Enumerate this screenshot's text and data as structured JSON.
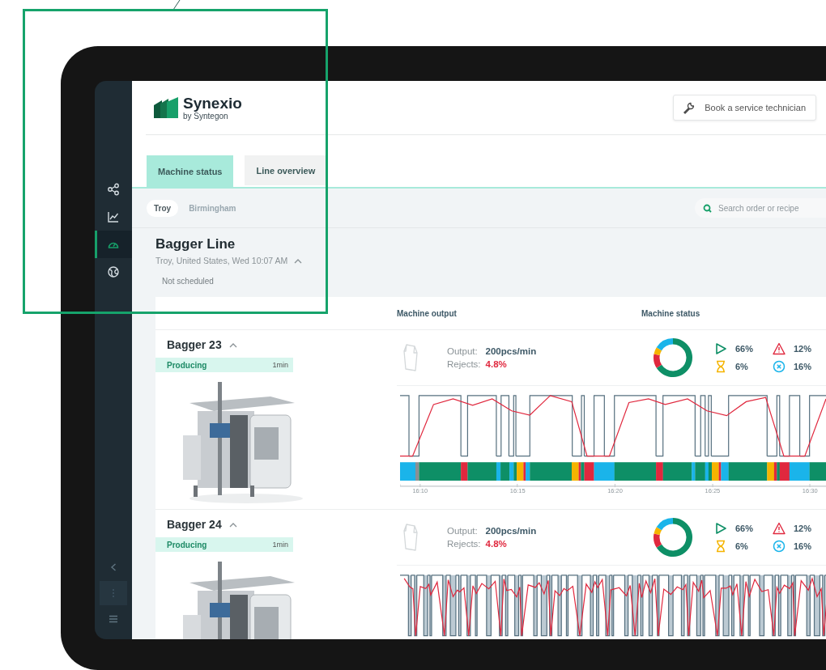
{
  "sidebar": {
    "nav_items": [
      {
        "kind": "network",
        "selected": false
      },
      {
        "kind": "chart",
        "selected": false
      },
      {
        "kind": "gauge",
        "selected": true
      },
      {
        "kind": "globe",
        "selected": false
      }
    ],
    "footer_items": [
      {
        "kind": "collapse",
        "selected": false
      },
      {
        "kind": "more",
        "selected": true
      },
      {
        "kind": "menu",
        "selected": false
      }
    ]
  },
  "header": {
    "logo": {
      "name": "Synexio",
      "tagline": "by Syntegon"
    },
    "action_button": "Book a service technician"
  },
  "tabs": [
    {
      "label": "Machine status",
      "selected": true
    },
    {
      "label": "Line overview",
      "selected": false
    }
  ],
  "locations": [
    {
      "label": "Troy",
      "selected": true
    },
    {
      "label": "Birmingham",
      "selected": false
    }
  ],
  "search": {
    "placeholder": "Search order or recipe"
  },
  "line": {
    "title": "Bagger Line",
    "subtitle": "Troy, United States, Wed 10:07 AM",
    "expanded": true,
    "schedule": "Not scheduled"
  },
  "table": {
    "columns": [
      "Machine output",
      "Machine status"
    ],
    "machines": [
      {
        "name": "Bagger 23",
        "expanded": true,
        "status": "Producing",
        "duration": "1min",
        "output_label": "Output:",
        "output": "200pcs/min",
        "rejects_label": "Rejects:",
        "rejects": "4.8%",
        "status_chart": {
          "chart_data": {
            "type": "donut",
            "values": [
              66,
              12,
              6,
              16
            ]
          }
        },
        "legend": [
          {
            "kind": "running",
            "value": "66%",
            "color": "#0e8f66"
          },
          {
            "kind": "fault",
            "value": "12%",
            "color": "#e0283e"
          },
          {
            "kind": "waiting",
            "value": "6%",
            "color": "#f5b400"
          },
          {
            "kind": "stopped",
            "value": "16%",
            "color": "#1ab4ea"
          }
        ],
        "timeline": {
          "kind": "sparse",
          "axis_labels": [
            "16:10",
            "16:15",
            "16:20",
            "16:25",
            "16:30"
          ]
        }
      },
      {
        "name": "Bagger 24",
        "expanded": true,
        "status": "Producing",
        "duration": "1min",
        "output_label": "Output:",
        "output": "200pcs/min",
        "rejects_label": "Rejects:",
        "rejects": "4.8%",
        "status_chart": {
          "chart_data": {
            "type": "donut",
            "values": [
              66,
              12,
              6,
              16
            ]
          }
        },
        "legend": [
          {
            "kind": "running",
            "value": "66%",
            "color": "#0e8f66"
          },
          {
            "kind": "fault",
            "value": "12%",
            "color": "#e0283e"
          },
          {
            "kind": "waiting",
            "value": "6%",
            "color": "#f5b400"
          },
          {
            "kind": "stopped",
            "value": "16%",
            "color": "#1ab4ea"
          }
        ],
        "timeline": {
          "kind": "dense"
        }
      }
    ]
  }
}
